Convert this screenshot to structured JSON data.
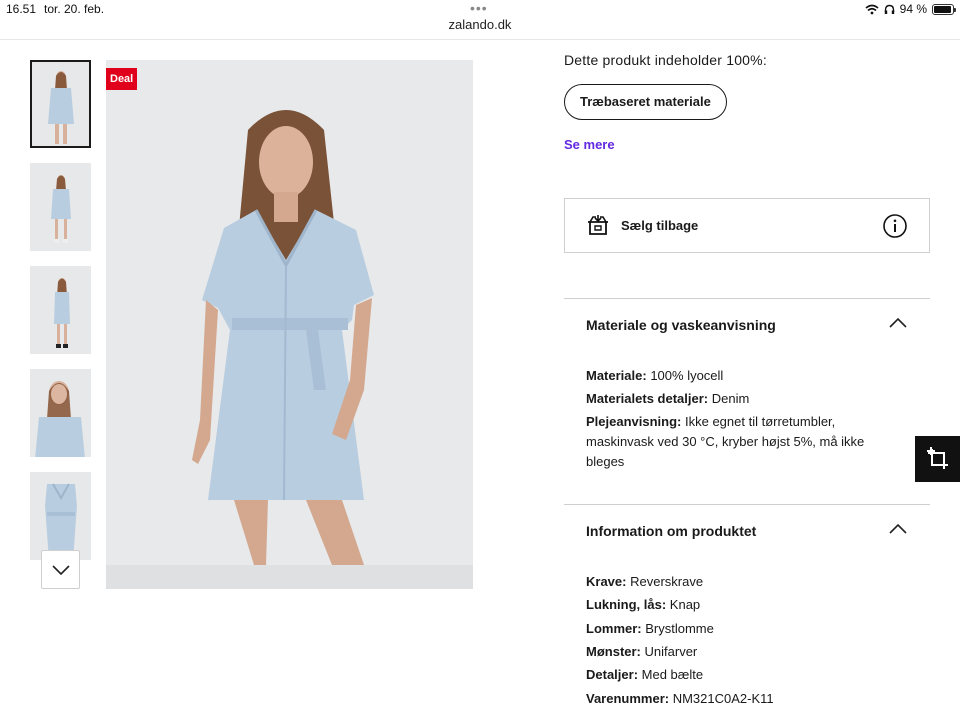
{
  "status_bar": {
    "time": "16.51",
    "date": "tor. 20. feb.",
    "url": "zalando.dk",
    "battery": "94 %",
    "battery_level": 0.94
  },
  "gallery": {
    "deal_badge": "Deal",
    "thumbnails": [
      "thumb-1",
      "thumb-2",
      "thumb-3",
      "thumb-4",
      "thumb-5"
    ],
    "active_index": 0
  },
  "material_info": {
    "contains_text": "Dette produkt indeholder 100%:",
    "chip_label": "Træbaseret materiale",
    "see_more": "Se mere"
  },
  "sell_back": {
    "label": "Sælg tilbage"
  },
  "sections": {
    "material": {
      "title": "Materiale og vaskeanvisning",
      "rows": [
        {
          "key": "Materiale:",
          "value": "100% lyocell"
        },
        {
          "key": "Materialets detaljer:",
          "value": "Denim"
        },
        {
          "key": "Plejeanvisning:",
          "value": "Ikke egnet til tørretumbler, maskinvask ved 30 °C, kryber højst 5%, må ikke bleges"
        }
      ]
    },
    "product": {
      "title": "Information om produktet",
      "rows": [
        {
          "key": "Krave:",
          "value": "Reverskrave"
        },
        {
          "key": "Lukning, lås:",
          "value": "Knap"
        },
        {
          "key": "Lommer:",
          "value": "Brystlomme"
        },
        {
          "key": "Mønster:",
          "value": "Unifarver"
        },
        {
          "key": "Detaljer:",
          "value": "Med bælte"
        },
        {
          "key": "Varenummer:",
          "value": "NM321C0A2-K11"
        }
      ]
    }
  },
  "colors": {
    "deal_red": "#e0001b",
    "link_purple": "#6328e0",
    "dress_blue": "#b9cde0"
  }
}
